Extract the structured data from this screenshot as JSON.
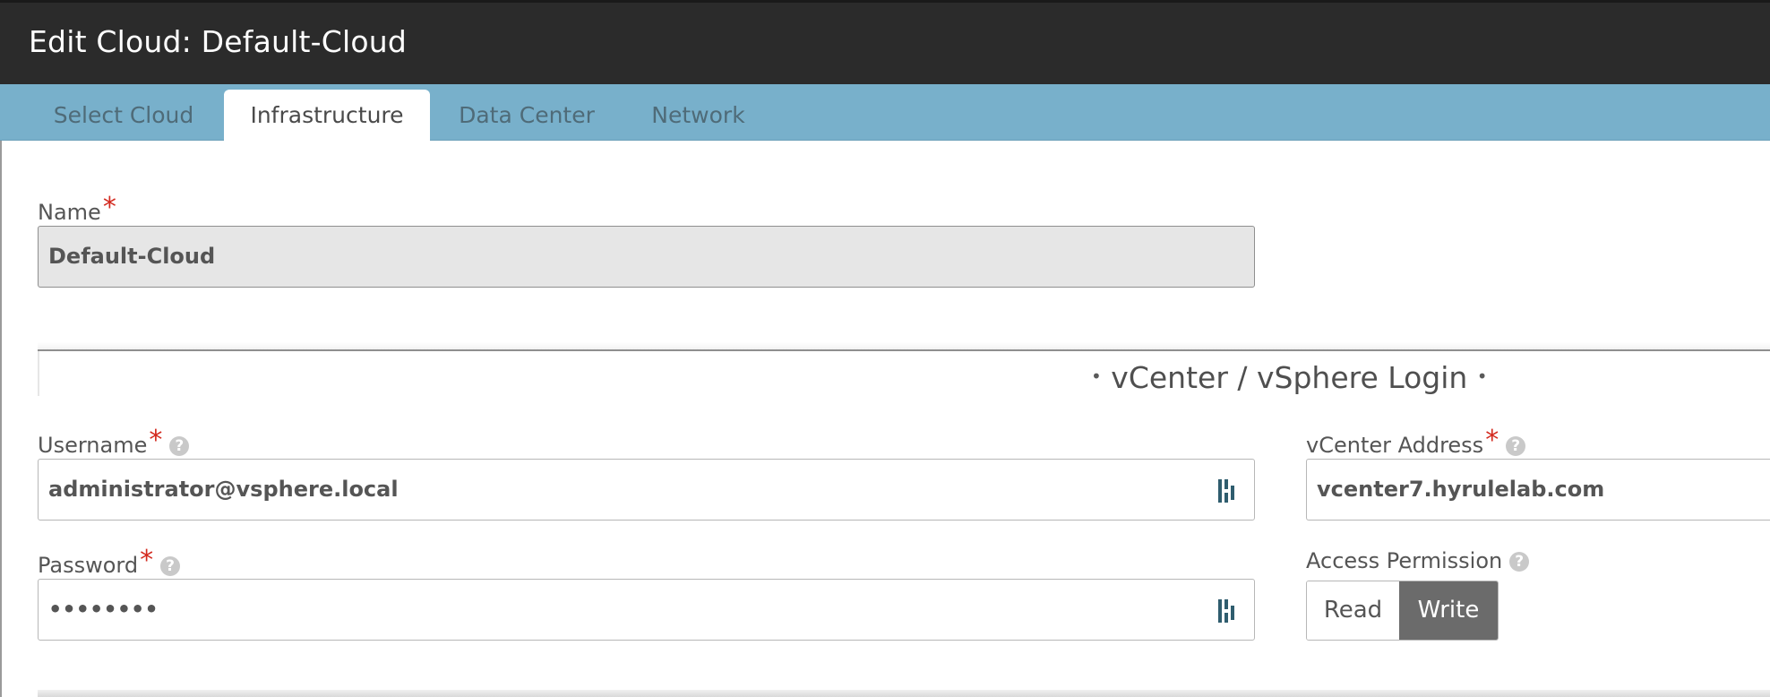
{
  "header": {
    "title": "Edit Cloud: Default-Cloud"
  },
  "tabs": [
    {
      "label": "Select Cloud",
      "active": false
    },
    {
      "label": "Infrastructure",
      "active": true
    },
    {
      "label": "Data Center",
      "active": false
    },
    {
      "label": "Network",
      "active": false
    }
  ],
  "name_field": {
    "label": "Name",
    "required_mark": "*",
    "value": "Default-Cloud"
  },
  "section": {
    "title": "vCenter / vSphere Login",
    "bullet": "•"
  },
  "username_field": {
    "label": "Username",
    "required_mark": "*",
    "help": "?",
    "value": "administrator@vsphere.local",
    "icon": "key-icon"
  },
  "password_field": {
    "label": "Password",
    "required_mark": "*",
    "help": "?",
    "value": "••••••••",
    "icon": "key-icon"
  },
  "vcenter_field": {
    "label": "vCenter Address",
    "required_mark": "*",
    "help": "?",
    "value": "vcenter7.hyrulelab.com"
  },
  "access_permission": {
    "label": "Access Permission",
    "help": "?",
    "options": [
      "Read",
      "Write"
    ],
    "selected": "Write"
  },
  "colors": {
    "header_bg": "#2b2b2b",
    "tabbar_bg": "#78b0cb",
    "required": "#d32a1f",
    "toggle_selected": "#6b6b6b"
  }
}
